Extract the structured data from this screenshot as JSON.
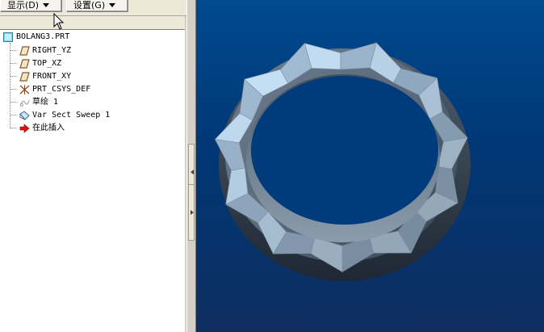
{
  "toolbar": {
    "display_label": "显示(D)",
    "settings_label": "设置(G)"
  },
  "tree": {
    "root": {
      "label": "BOLANG3.PRT",
      "icon": "part-icon"
    },
    "items": [
      {
        "label": "RIGHT_YZ",
        "icon": "datum-plane-icon"
      },
      {
        "label": "TOP_XZ",
        "icon": "datum-plane-icon"
      },
      {
        "label": "FRONT_XY",
        "icon": "datum-plane-icon"
      },
      {
        "label": "PRT_CSYS_DEF",
        "icon": "coordinate-system-icon"
      },
      {
        "label": "草绘 1",
        "icon": "sketch-icon"
      },
      {
        "label": "Var Sect Sweep 1",
        "icon": "sweep-feature-icon"
      },
      {
        "label": "在此插入",
        "icon": "insert-here-arrow-icon"
      }
    ]
  },
  "viewport": {
    "model": "wavy-ring-icon",
    "background_top": "#004a8e",
    "background_bottom": "#0f2e60"
  }
}
